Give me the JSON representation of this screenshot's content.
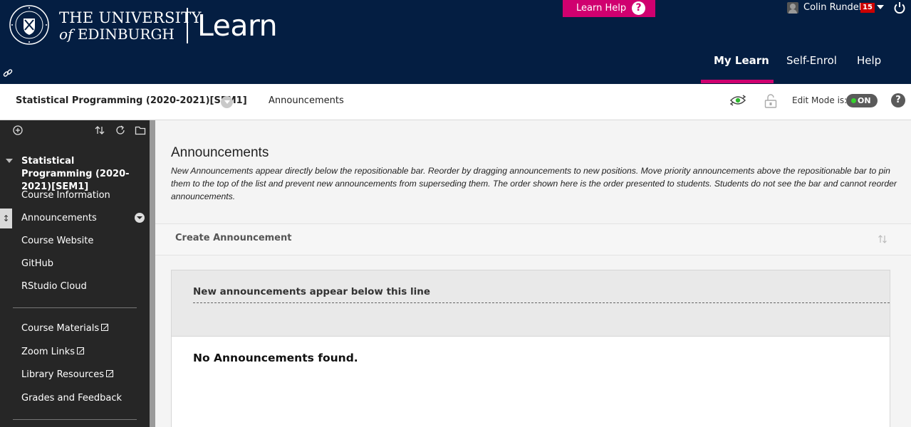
{
  "header": {
    "university_line1": "THE UNIVERSITY",
    "university_of": "of",
    "university_line2": "EDINBURGH",
    "app_title": "Learn",
    "learn_help": "Learn Help",
    "help_glyph": "?",
    "user_name": "Colin Rundel",
    "notification_count": "15",
    "nav": [
      "My Learn",
      "Self-Enrol",
      "Help"
    ],
    "active_nav": "My Learn"
  },
  "breadcrumb": {
    "course": "Statistical Programming (2020-2021)[SEM1]",
    "current": "Announcements",
    "edit_mode_label": "Edit Mode is:",
    "edit_mode_value": "ON",
    "help_glyph": "?"
  },
  "sidebar": {
    "course_title": "Statistical Programming (2020-2021)[SEM1]",
    "group1": [
      "Course Information",
      "Announcements",
      "Course Website",
      "GitHub",
      "RStudio Cloud"
    ],
    "group2": [
      "Course Materials",
      "Zoom Links",
      "Library Resources",
      "Grades and Feedback"
    ],
    "selected": "Announcements",
    "external_links": [
      "Course Materials",
      "Zoom Links",
      "Library Resources"
    ],
    "handle_glyph": "↕"
  },
  "main": {
    "title": "Announcements",
    "description": "New Announcements appear directly below the repositionable bar. Reorder by dragging announcements to new positions. Move priority announcements above the repositionable bar to pin them to the top of the list and prevent new announcements from superseding them. The order shown here is the order presented to students. Students do not see the bar and cannot reorder announcements.",
    "create_button": "Create Announcement",
    "repositionable_label": "New announcements appear below this line",
    "empty_message": "No Announcements found."
  },
  "colors": {
    "header_bg": "#041e42",
    "accent": "#d0006f",
    "sidebar_bg": "#262626",
    "toggle_on": "#36d32e"
  },
  "icons": [
    "university-seal-icon",
    "help-icon",
    "avatar-icon",
    "chevron-down-icon",
    "power-icon",
    "link-icon",
    "eye-icon",
    "lock-icon",
    "add-icon",
    "sort-icon",
    "refresh-icon",
    "folder-icon",
    "external-link-icon"
  ]
}
